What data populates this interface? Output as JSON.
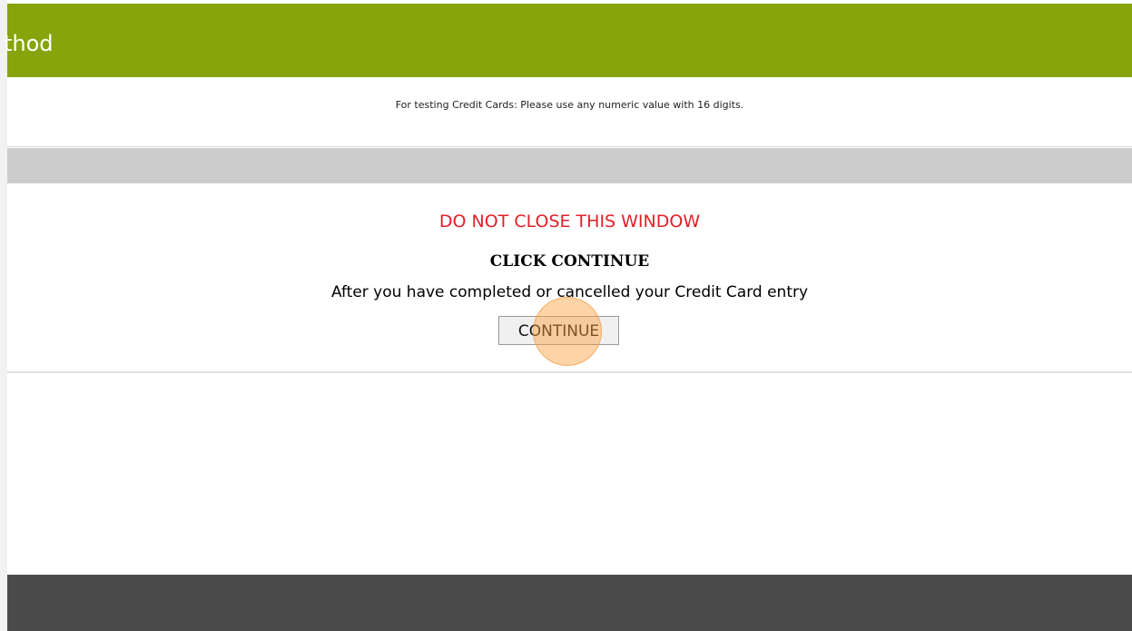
{
  "header": {
    "title": "thod",
    "color": "#87a40d"
  },
  "notice": {
    "testing_text": "For testing Credit Cards: Please use any numeric value with 16 digits."
  },
  "main": {
    "warning": "DO NOT CLOSE THIS WINDOW",
    "warning_color": "#e3202a",
    "click_heading": "CLICK CONTINUE",
    "instruction": "After you have completed or cancelled your Credit Card entry",
    "continue_label": "CONTINUE"
  },
  "footer": {
    "color": "#4b4b4b"
  }
}
